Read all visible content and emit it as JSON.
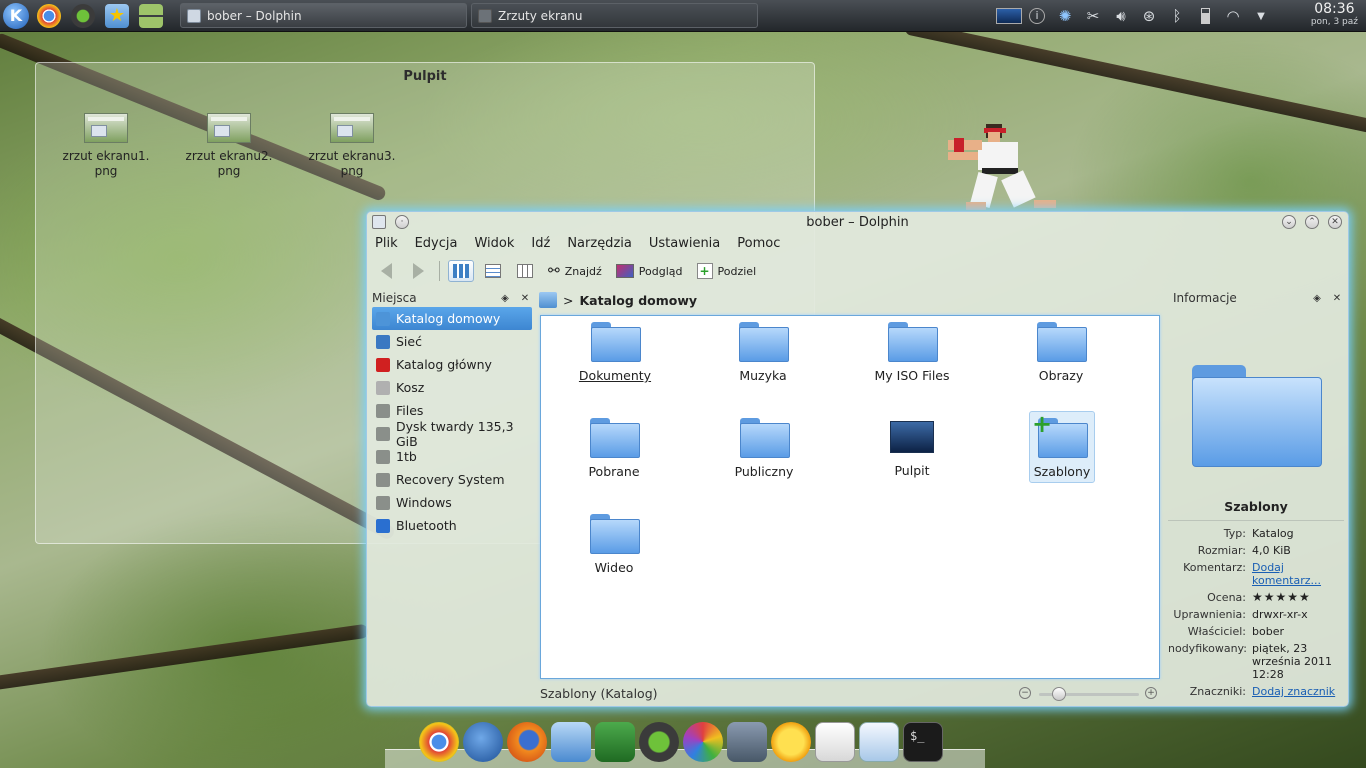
{
  "panel": {
    "tasks": [
      {
        "label": "bober – Dolphin"
      },
      {
        "label": "Zrzuty ekranu"
      }
    ],
    "clock": {
      "time": "08:36",
      "date": "pon, 3 paź"
    }
  },
  "desktop": {
    "title": "Pulpit",
    "icons": [
      {
        "line1": "zrzut ekranu1.",
        "line2": "png"
      },
      {
        "line1": "zrzut ekranu2.",
        "line2": "png"
      },
      {
        "line1": "zrzut ekranu3.",
        "line2": "png"
      }
    ]
  },
  "window": {
    "title": "bober – Dolphin",
    "menu": [
      "Plik",
      "Edycja",
      "Widok",
      "Idź",
      "Narzędzia",
      "Ustawienia",
      "Pomoc"
    ],
    "toolbar": {
      "find": "Znajdź",
      "preview": "Podgląd",
      "split": "Podziel"
    },
    "places": {
      "title": "Miejsca",
      "items": [
        {
          "label": "Katalog domowy",
          "icon": "home-icon",
          "color": "#4d94d8"
        },
        {
          "label": "Sieć",
          "icon": "network-icon",
          "color": "#3a78c2"
        },
        {
          "label": "Katalog główny",
          "icon": "root-folder-icon",
          "color": "#d02020"
        },
        {
          "label": "Kosz",
          "icon": "trash-icon",
          "color": "#b0b0b0"
        },
        {
          "label": "Files",
          "icon": "drive-icon",
          "color": "#8a8f8a"
        },
        {
          "label": "Dysk twardy 135,3 GiB",
          "icon": "drive-icon",
          "color": "#8a8f8a"
        },
        {
          "label": "1tb",
          "icon": "drive-icon",
          "color": "#8a8f8a"
        },
        {
          "label": "Recovery System",
          "icon": "drive-icon",
          "color": "#8a8f8a"
        },
        {
          "label": "Windows",
          "icon": "drive-icon",
          "color": "#8a8f8a"
        },
        {
          "label": "Bluetooth",
          "icon": "bluetooth-icon",
          "color": "#2a6fd0"
        }
      ]
    },
    "breadcrumb": {
      "current": "Katalog domowy"
    },
    "files": [
      {
        "label": "Dokumenty"
      },
      {
        "label": "Muzyka"
      },
      {
        "label": "My ISO Files"
      },
      {
        "label": "Obrazy"
      },
      {
        "label": "Pobrane"
      },
      {
        "label": "Publiczny"
      },
      {
        "label": "Pulpit"
      },
      {
        "label": "Szablony"
      },
      {
        "label": "Wideo"
      }
    ],
    "status": "Szablony (Katalog)",
    "zoom_level": 0.2,
    "info": {
      "title": "Informacje",
      "name": "Szablony",
      "type_k": "Typ:",
      "type_v": "Katalog",
      "size_k": "Rozmiar:",
      "size_v": "4,0 KiB",
      "comment_k": "Komentarz:",
      "comment_v": "Dodaj komentarz...",
      "rating_k": "Ocena:",
      "rating_v": 0,
      "perm_k": "Uprawnienia:",
      "perm_v": "drwxr-xr-x",
      "owner_k": "Właściciel:",
      "owner_v": "bober",
      "modified_k": "nodyfikowany:",
      "modified_v": "piątek, 23 września 2011 12:28",
      "tags_k": "Znaczniki:",
      "tags_v": "Dodaj znacznik"
    }
  }
}
